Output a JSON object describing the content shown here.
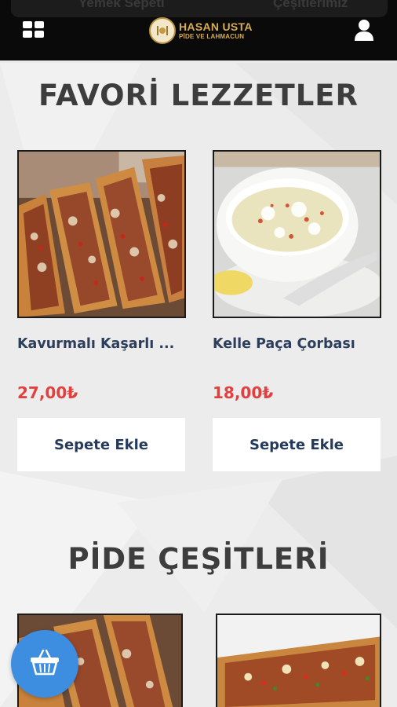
{
  "header": {
    "peek_left": "Yemek Sepeti",
    "peek_right": "Çeşitlerimiz",
    "logo_title": "HASAN USTA",
    "logo_sub": "PİDE VE LAHMACUN"
  },
  "sections": {
    "favorites_title": "FAVORİ LEZZETLER",
    "pide_title": "PİDE ÇEŞİTLERİ"
  },
  "products": [
    {
      "name": "Kavurmalı Kaşarlı ...",
      "price": "27,00₺",
      "button": "Sepete Ekle",
      "image": "pide-photo"
    },
    {
      "name": "Kelle Paça Çorbası",
      "price": "18,00₺",
      "button": "Sepete Ekle",
      "image": "soup-photo"
    }
  ],
  "colors": {
    "header_bg": "#0a0a0a",
    "accent_gold": "#d7ad4f",
    "price_red": "#e2403f",
    "name_navy": "#2c3e5c",
    "fab_blue": "#3d8ee0"
  },
  "icons": {
    "menu": "grid-menu-icon",
    "user": "user-icon",
    "cart": "shopping-basket-icon"
  }
}
